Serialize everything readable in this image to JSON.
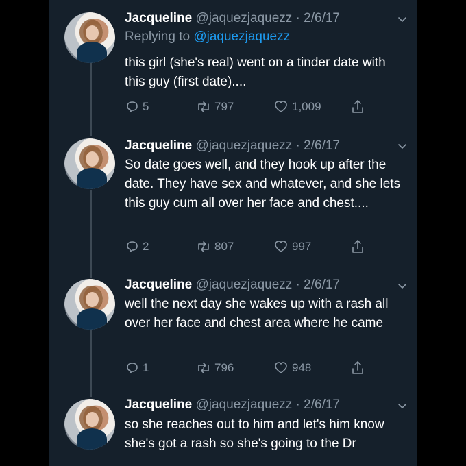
{
  "tweets": [
    {
      "author_name": "Jacqueline",
      "author_handle": "@jaquezjaquezz",
      "separator": "·",
      "date": "2/6/17",
      "reply_prefix": "Replying to",
      "reply_handle": "@jaquezjaquezz",
      "text": "this girl (she's real) went on a tinder date with this guy (first date)....",
      "replies": "5",
      "retweets": "797",
      "likes": "1,009"
    },
    {
      "author_name": "Jacqueline",
      "author_handle": "@jaquezjaquezz",
      "separator": "·",
      "date": "2/6/17",
      "text": "So date goes well, and they hook up after the date. They have sex and whatever, and she lets this guy cum all over her face and chest....",
      "replies": "2",
      "retweets": "807",
      "likes": "997"
    },
    {
      "author_name": "Jacqueline",
      "author_handle": "@jaquezjaquezz",
      "separator": "·",
      "date": "2/6/17",
      "text": "well the next day she wakes up with a rash all over her face and chest area where he came",
      "replies": "1",
      "retweets": "796",
      "likes": "948"
    },
    {
      "author_name": "Jacqueline",
      "author_handle": "@jaquezjaquezz",
      "separator": "·",
      "date": "2/6/17",
      "text": "so she reaches out to him and let's him know she's got a rash so she's going to the Dr"
    }
  ],
  "icons": {
    "reply": "reply-icon",
    "retweet": "retweet-icon",
    "like": "heart-icon",
    "share": "share-icon",
    "more": "chevron-down-icon"
  },
  "colors": {
    "background": "#15202b",
    "text": "#ffffff",
    "muted": "#8b98a5",
    "link": "#1d9bf0",
    "thread_line": "#3d4954"
  }
}
